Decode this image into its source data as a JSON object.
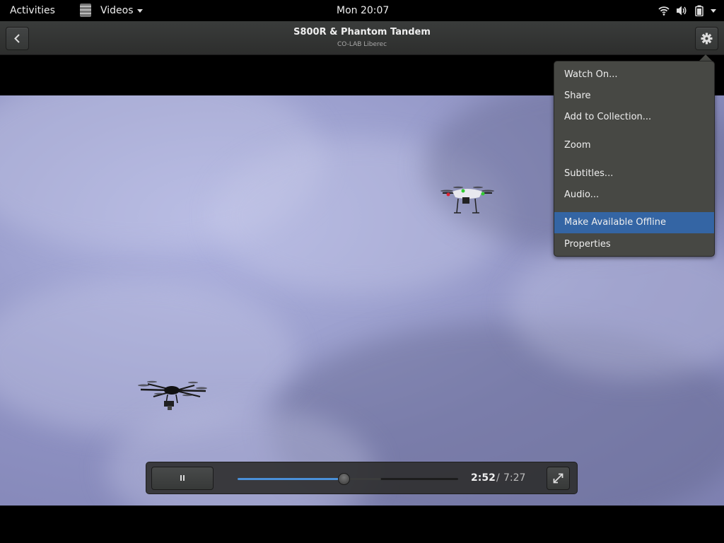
{
  "topbar": {
    "activities": "Activities",
    "app_name": "Videos",
    "clock": "Mon 20:07"
  },
  "header": {
    "title": "S800R & Phantom Tandem",
    "subtitle": "CO-LAB Liberec"
  },
  "menu": {
    "items": [
      {
        "label": "Watch On..."
      },
      {
        "label": "Share"
      },
      {
        "label": "Add to Collection..."
      },
      {
        "label": "Zoom"
      },
      {
        "label": "Subtitles..."
      },
      {
        "label": "Audio..."
      },
      {
        "label": "Make Available Offline"
      },
      {
        "label": "Properties"
      }
    ],
    "selected": "Make Available Offline"
  },
  "player": {
    "time_current": "2:52",
    "time_separator": "/",
    "time_total": "7:27",
    "progress": 0.482,
    "buffered": 0.65
  },
  "colors": {
    "accent": "#3465a4",
    "progress": "#4a90d9"
  }
}
